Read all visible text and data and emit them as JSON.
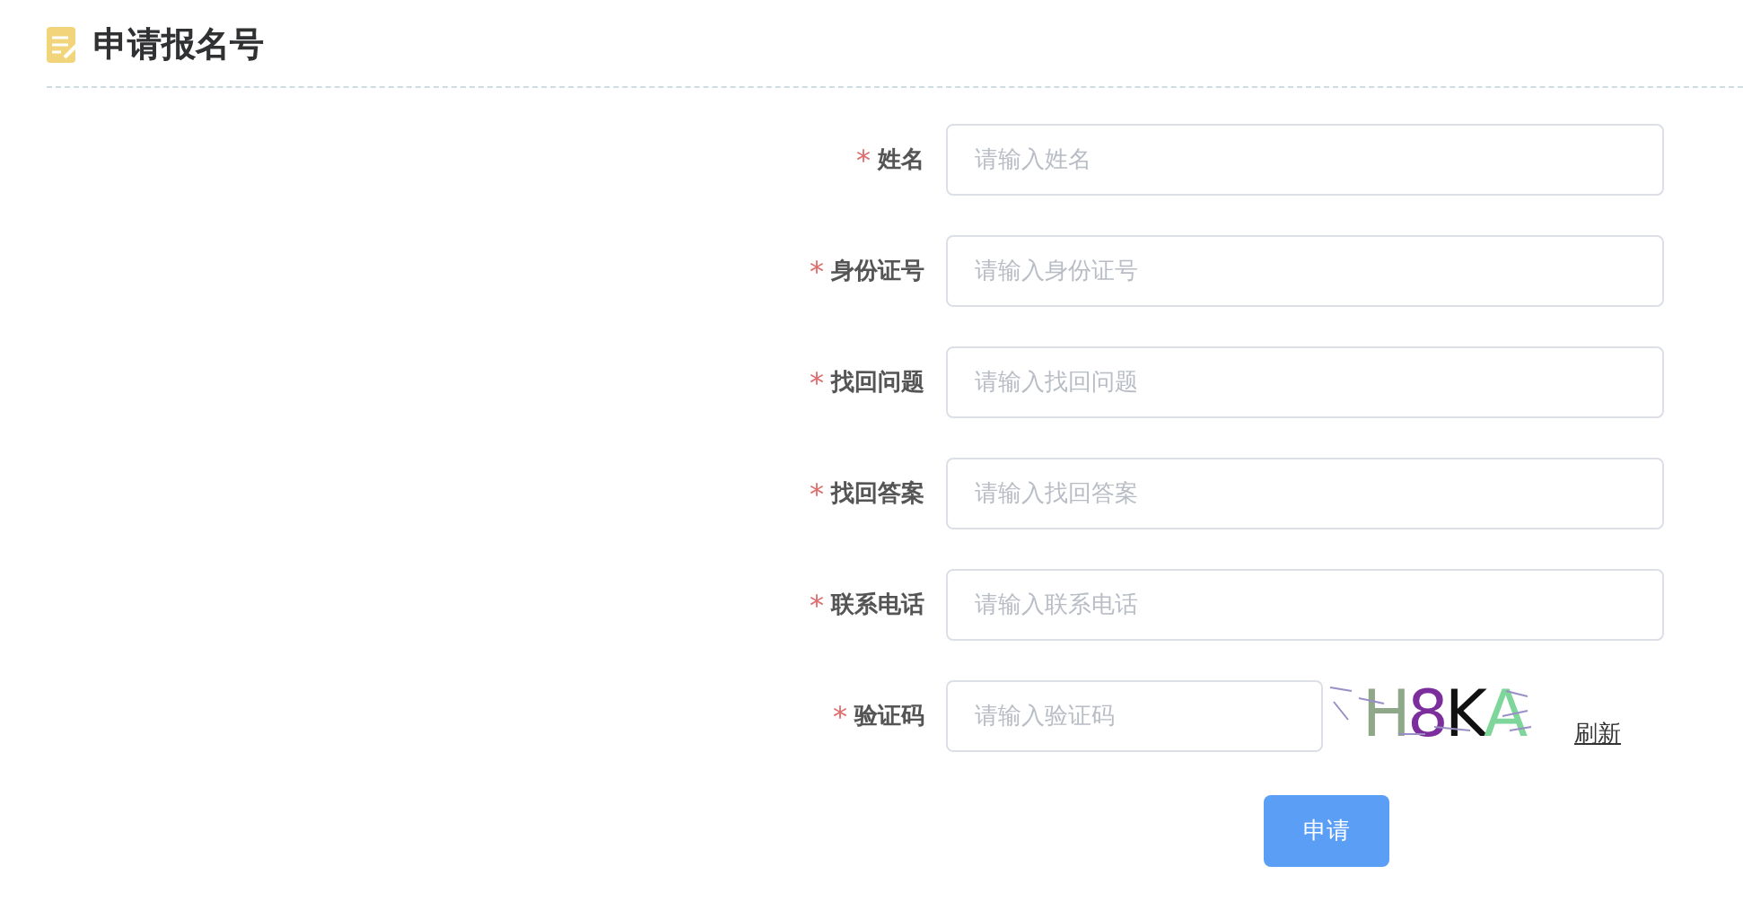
{
  "title": "申请报名号",
  "fields": [
    {
      "mark": "*",
      "label": "姓名",
      "placeholder": "请输入姓名"
    },
    {
      "mark": "*",
      "label": "身份证号",
      "placeholder": "请输入身份证号"
    },
    {
      "mark": "*",
      "label": "找回问题",
      "placeholder": "请输入找回问题"
    },
    {
      "mark": "*",
      "label": "找回答案",
      "placeholder": "请输入找回答案"
    },
    {
      "mark": "*",
      "label": "联系电话",
      "placeholder": "请输入联系电话"
    }
  ],
  "captcha": {
    "mark": "*",
    "label": "验证码",
    "placeholder": "请输入验证码",
    "characters": [
      {
        "char": "H",
        "color": "#8fa88a"
      },
      {
        "char": "8",
        "color": "#7b2e9c"
      },
      {
        "char": "K",
        "color": "#111111"
      },
      {
        "char": "A",
        "color": "#7ed69a"
      }
    ],
    "refresh": "刷新"
  },
  "submit": "申请"
}
